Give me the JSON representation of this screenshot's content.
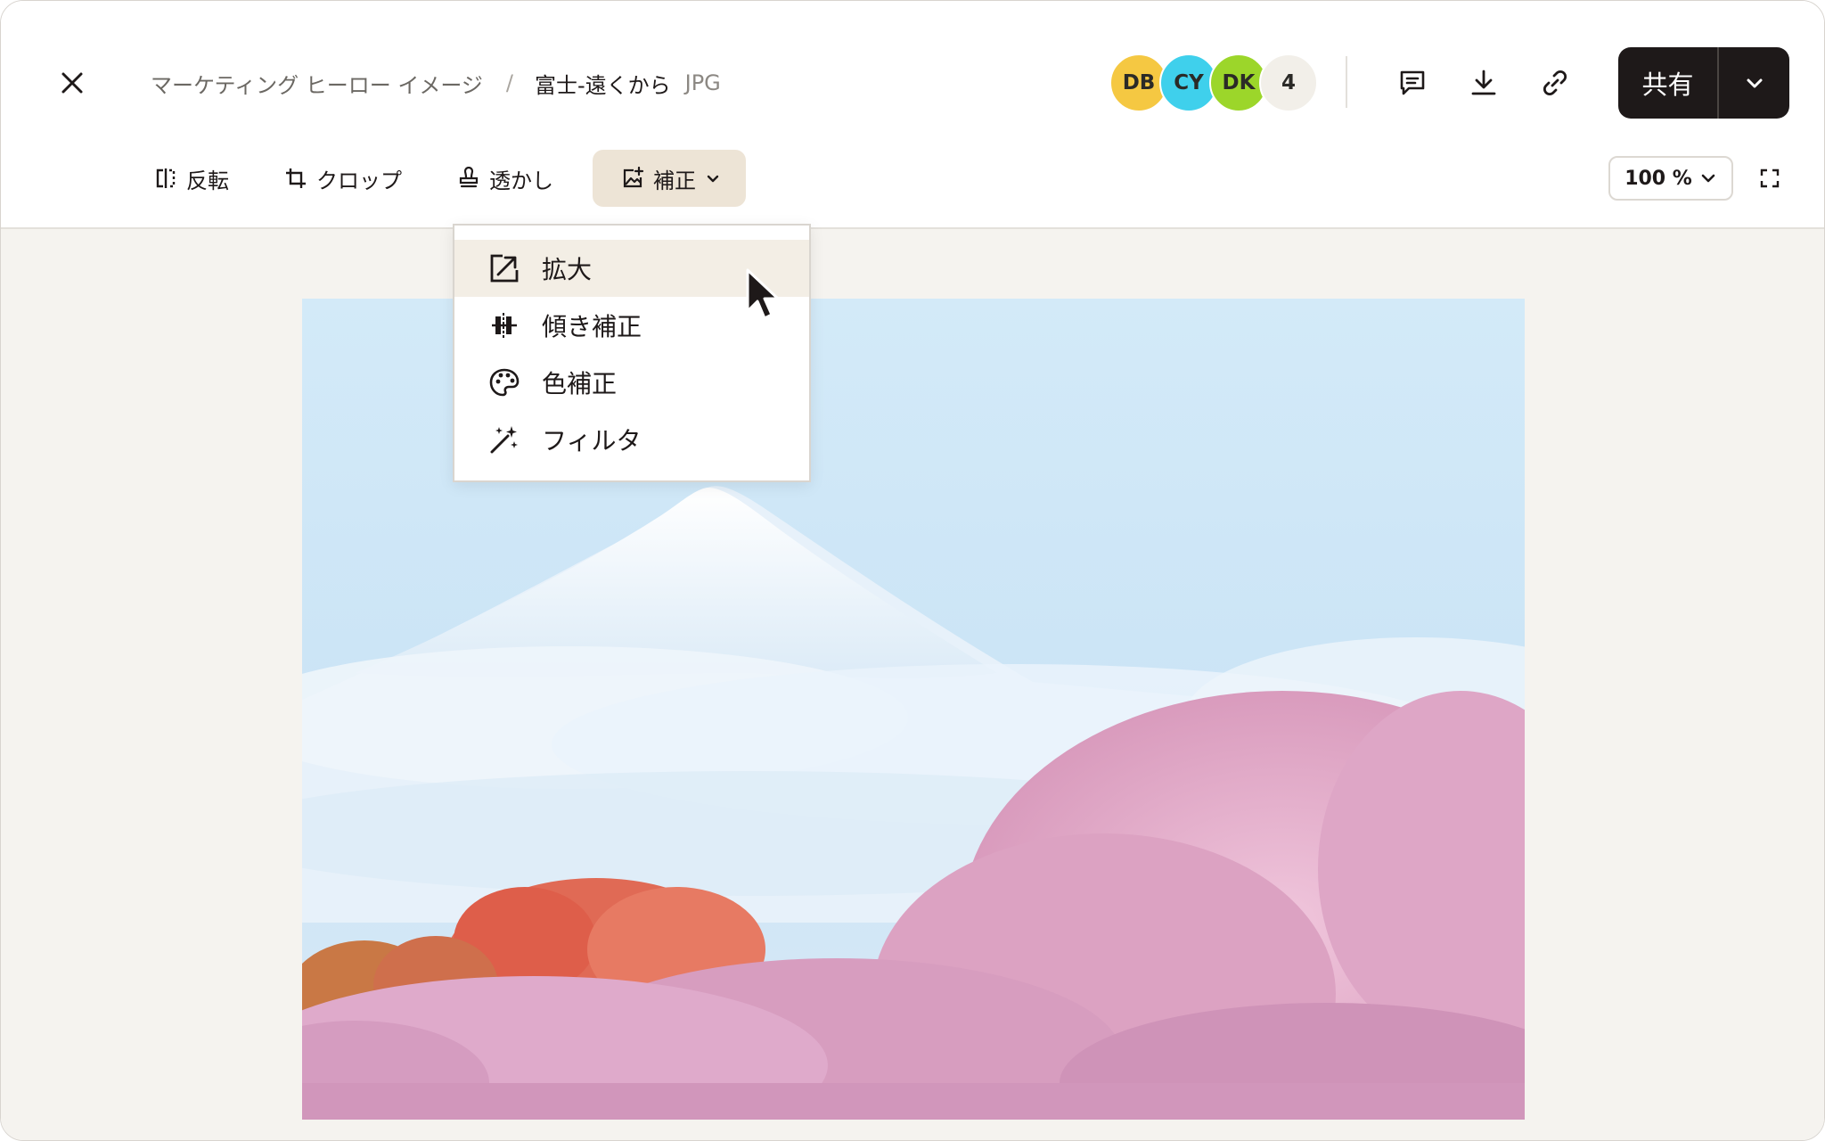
{
  "header": {
    "breadcrumb_parent": "マーケティング ヒーロー イメージ",
    "breadcrumb_separator": "/",
    "file_name": "富士-遠くから",
    "file_type": "JPG"
  },
  "collaborators": [
    {
      "initials": "DB",
      "color": "#f5c842"
    },
    {
      "initials": "CY",
      "color": "#3fd0ec"
    },
    {
      "initials": "DK",
      "color": "#9cd62a"
    }
  ],
  "collaborator_count": "4",
  "share": {
    "label": "共有"
  },
  "toolbar": {
    "flip": "反転",
    "crop": "クロップ",
    "watermark": "透かし",
    "adjust": "補正"
  },
  "zoom": {
    "value": "100 %"
  },
  "adjust_menu": {
    "items": [
      {
        "label": "拡大",
        "icon": "expand-icon"
      },
      {
        "label": "傾き補正",
        "icon": "straighten-icon"
      },
      {
        "label": "色補正",
        "icon": "palette-icon"
      },
      {
        "label": "フィルタ",
        "icon": "magic-wand-icon"
      }
    ],
    "hovered_item": "拡大"
  },
  "colors": {
    "accent_dark": "#1e1919",
    "active_tool_bg": "#ede4d6",
    "canvas_bg": "#f5f3ef"
  }
}
